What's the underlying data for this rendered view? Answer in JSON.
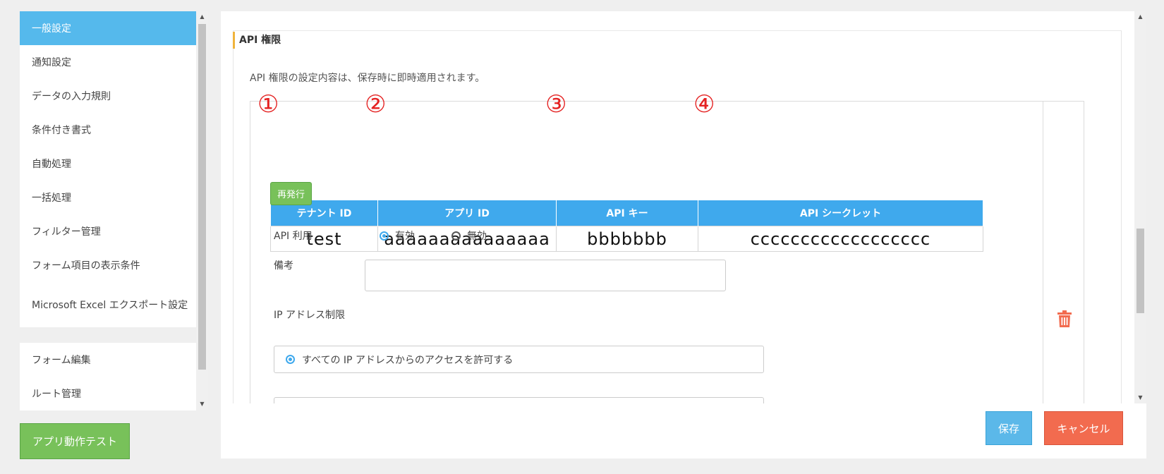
{
  "sidebar": {
    "items": [
      {
        "label": "一般設定"
      },
      {
        "label": "通知設定"
      },
      {
        "label": "データの入力規則"
      },
      {
        "label": "条件付き書式"
      },
      {
        "label": "自動処理"
      },
      {
        "label": "一括処理"
      },
      {
        "label": "フィルター管理"
      },
      {
        "label": "フォーム項目の表示条件"
      },
      {
        "label": "Microsoft Excel エクスポート設定"
      }
    ],
    "items2": [
      {
        "label": "フォーム編集"
      },
      {
        "label": "ルート管理"
      }
    ],
    "test_button": "アプリ動作テスト"
  },
  "section": {
    "title": "API 権限",
    "description": "API 権限の設定内容は、保存時に即時適用されます。"
  },
  "annotations": [
    "①",
    "②",
    "③",
    "④"
  ],
  "api_table": {
    "headers": [
      "テナント ID",
      "アプリ ID",
      "API キー",
      "API シークレット"
    ],
    "row": [
      "test",
      "aaaaaaaaaaaaaaa",
      "bbbbbbb",
      "cccccccccccccccccc"
    ]
  },
  "reissue_label": "再発行",
  "api_usage": {
    "label": "API 利用",
    "options": [
      "有効",
      "無効"
    ],
    "selected": "有効"
  },
  "note": {
    "label": "備考",
    "value": ""
  },
  "ip_restriction": {
    "label": "IP アドレス制限",
    "option_all": "すべての IP アドレスからのアクセスを許可する"
  },
  "footer": {
    "save": "保存",
    "cancel": "キャンセル"
  },
  "colors": {
    "active": "#55b9ec",
    "header": "#3fa9ed",
    "green": "#78c15a",
    "cancel": "#f26b4f",
    "annotation": "#e42222"
  }
}
